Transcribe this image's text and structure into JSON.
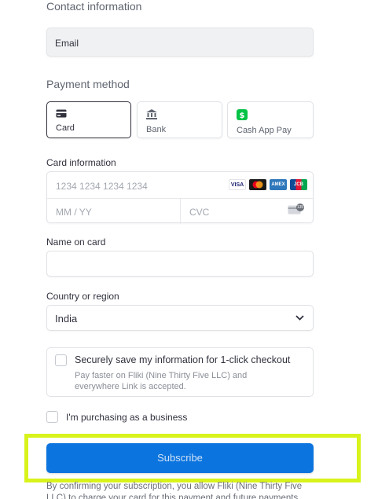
{
  "contact": {
    "title": "Contact information",
    "email_placeholder": "Email"
  },
  "payment": {
    "title": "Payment method",
    "tabs": [
      {
        "label": "Card",
        "icon": "card-icon",
        "selected": true
      },
      {
        "label": "Bank",
        "icon": "bank-icon",
        "selected": false
      },
      {
        "label": "Cash App Pay",
        "icon": "cash-app-icon",
        "selected": false
      }
    ]
  },
  "card": {
    "label": "Card information",
    "number_placeholder": "1234 1234 1234 1234",
    "expiry_placeholder": "MM / YY",
    "cvc_placeholder": "CVC",
    "brands": [
      "VISA",
      "mastercard-icon",
      "AMEX",
      "JCB"
    ],
    "cvc_icon_text": "135"
  },
  "name": {
    "label": "Name on card",
    "value": ""
  },
  "country": {
    "label": "Country or region",
    "selected": "India"
  },
  "save_info": {
    "title": "Securely save my information for 1-click checkout",
    "subtitle_line1": "Pay faster on Fliki (Nine Thirty Five LLC) and",
    "subtitle_line2": "everywhere Link is accepted."
  },
  "business": {
    "label": "I'm purchasing as a business"
  },
  "subscribe": {
    "label": "Subscribe"
  },
  "legal": {
    "line1": "By confirming your subscription, you allow Fliki (Nine Thirty Five",
    "line2": "LLC) to charge your card for this payment and future payments"
  },
  "colors": {
    "accent": "#0b74de",
    "highlight": "#d8f31c"
  }
}
